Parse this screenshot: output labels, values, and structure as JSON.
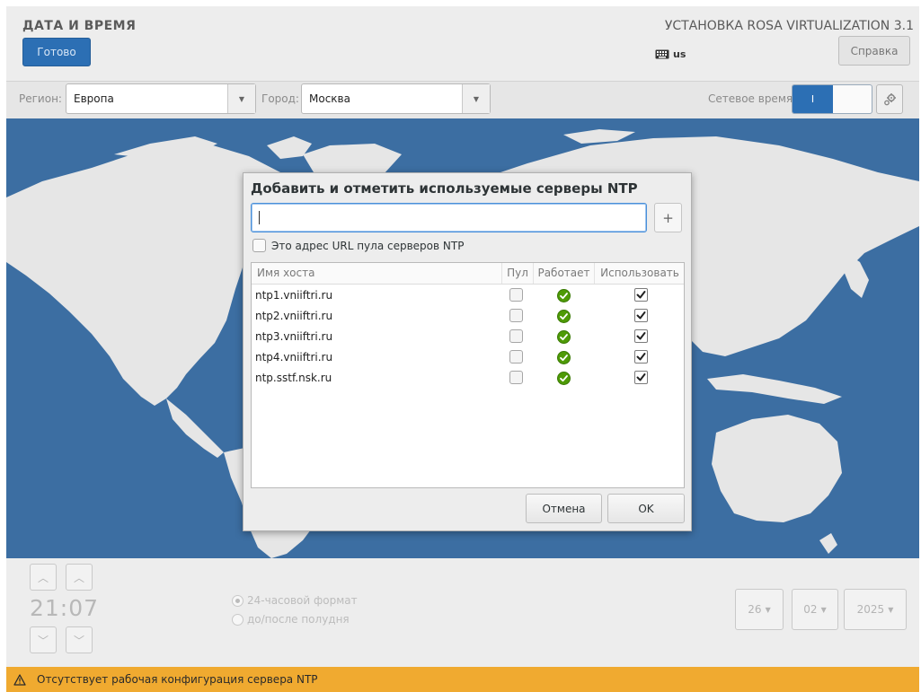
{
  "header": {
    "title": "ДАТА И ВРЕМЯ",
    "done_label": "Готово",
    "product": "УСТАНОВКА ROSA VIRTUALIZATION 3.1",
    "keyboard_layout": "us",
    "help_label": "Справка"
  },
  "toolbar": {
    "region_label": "Регион:",
    "region_value": "Европа",
    "city_label": "Город:",
    "city_value": "Москва",
    "network_time_label": "Сетевое время",
    "network_time_switch_on_text": "I",
    "network_time_enabled": true
  },
  "dialog": {
    "title": "Добавить и отметить используемые серверы NTP",
    "input_value": "",
    "add_label": "+",
    "pool_checkbox_label": "Это адрес URL пула серверов NTP",
    "pool_checkbox_checked": false,
    "columns": [
      "Имя хоста",
      "Пул",
      "Работает",
      "Использовать"
    ],
    "servers": [
      {
        "host": "ntp1.vniiftri.ru",
        "pool": false,
        "working": true,
        "use": true
      },
      {
        "host": "ntp2.vniiftri.ru",
        "pool": false,
        "working": true,
        "use": true
      },
      {
        "host": "ntp3.vniiftri.ru",
        "pool": false,
        "working": true,
        "use": true
      },
      {
        "host": "ntp4.vniiftri.ru",
        "pool": false,
        "working": true,
        "use": true
      },
      {
        "host": "ntp.sstf.nsk.ru",
        "pool": false,
        "working": true,
        "use": true
      }
    ],
    "cancel_label": "Отмена",
    "ok_label": "OK"
  },
  "time": {
    "clock": "21:07",
    "format_24h_label": "24-часовой формат",
    "format_ampm_label": "до/после полудня",
    "selected_format": "24h",
    "day": "26",
    "month": "02",
    "year": "2025"
  },
  "warning": {
    "text": "Отсутствует рабочая конфигурация сервера NTP",
    "icon": "warning-icon"
  },
  "colors": {
    "accent": "#2c6fb4",
    "map_ocean": "#3c6ea2",
    "map_land": "#e6e6e6",
    "warning_bar": "#f0aa30",
    "status_ok": "#4e9a06"
  }
}
